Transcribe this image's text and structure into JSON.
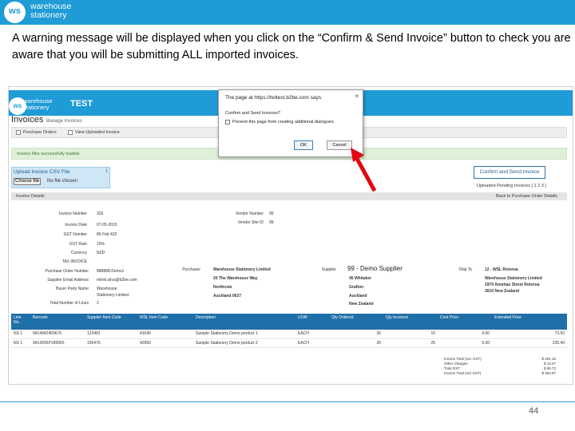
{
  "slide": {
    "brand_line1": "warehouse",
    "brand_line2": "stationery",
    "logo_text": "ws",
    "caption": "A warning message will be displayed when you click on the “Confirm & Send Invoice” button to check you are aware that you will be submitting ALL imported invoices.",
    "page_number": "44",
    "accent_color": "#1f9bd6"
  },
  "app": {
    "env_label": "TEST",
    "page_title": "Invoices",
    "page_subtitle": "Manage Invoices",
    "tabs": [
      "Purchase Orders",
      "View Uploaded Invoice"
    ],
    "alert_text": "Invoice files successfully loaded.",
    "upload": {
      "title": "Upload Invoice CSV File",
      "help_icon": "i",
      "choose_file": "Choose file",
      "no_file": "No file chosen"
    },
    "confirm_button": "Confirm and Send Invoice",
    "pending_label": "Uploaded Pending Invoices [ 1 2 3 ]",
    "back_link": "Back to Purchase Order Details",
    "details_label": "Invoice Details",
    "invoice_fields": [
      {
        "label": "Invoice Number",
        "value": "333"
      },
      {
        "label": "Invoice Date",
        "value": "07-05-2015"
      },
      {
        "label": "GST Number",
        "value": "86 Feb 432"
      },
      {
        "label": "GST Rate",
        "value": "15%"
      },
      {
        "label": "Currency",
        "value": "NZD"
      }
    ],
    "vendor_fields": [
      {
        "label": "Vendor Number",
        "value": "99"
      },
      {
        "label": "Vendor Site ID",
        "value": "99"
      }
    ],
    "tax_invoice_label": "TAX INVOICE",
    "po_fields": [
      {
        "label": "Purchase Order Number",
        "value": "888888-Demo1"
      },
      {
        "label": "Supplier Email Address",
        "value": "mitrel.silva@b2be.com"
      },
      {
        "label": "Buyer Party Name",
        "value": "Warehouse"
      },
      {
        "label": "",
        "value": "Stationery Limited"
      },
      {
        "label": "Total Number of Lines",
        "value": "2"
      }
    ],
    "purchaser": {
      "label": "Purchaser",
      "lines": [
        "Warehouse Stationery Limited",
        "20 The Warehouse Way",
        "Northcote",
        "Auckland 0627"
      ]
    },
    "supplier": {
      "label": "Supplier",
      "name": "99 - Demo Supplier",
      "lines": [
        "45 Whitaker",
        "Grafton",
        "Auckland",
        "New Zealand"
      ]
    },
    "ship_to": {
      "label": "Ship To",
      "lines": [
        "12 - WSL Rotorua",
        "Warehouse Stationery Limited",
        "1970 Amohau Street Rotorua",
        "3010 New Zealand"
      ]
    },
    "table": {
      "headers": [
        "Line No.",
        "Barcode",
        "Supplier Item Code",
        "WSL Item Code",
        "Description",
        "UOM",
        "Qty Ordered",
        "Qty Invoiced",
        "Cost Price",
        "Extended Price"
      ],
      "rows": [
        [
          "NS 1",
          "9414942459676",
          "123481",
          "41645",
          "Sample Stationery Demo product 1",
          "EACH",
          "35",
          "15",
          "4.90",
          "73.50"
        ],
        [
          "NS 1",
          "9414265P189965",
          "156476",
          "42950",
          "Sample Stationery Demo product 2",
          "EACH",
          "35",
          "25",
          "5.90",
          "235.40"
        ]
      ]
    },
    "totals": [
      {
        "label": "Invoice Total (exc GST)",
        "value": "$ 281.15"
      },
      {
        "label": "Other Charges",
        "value": "$ 13.07"
      },
      {
        "label": "Total GST",
        "value": "$ 68.72"
      },
      {
        "label": "Invoice Total (incl GST)",
        "value": "$ 354.87"
      }
    ]
  },
  "dialog": {
    "title": "The page at https://twltest.b2be.com says:",
    "close_icon": "×",
    "message": "Confirm and Send Invoices?",
    "checkbox_label": "Prevent this page from creating additional dialogues.",
    "ok": "OK",
    "cancel": "Cancel"
  },
  "annotation": {
    "arrow_color": "#e30613"
  }
}
